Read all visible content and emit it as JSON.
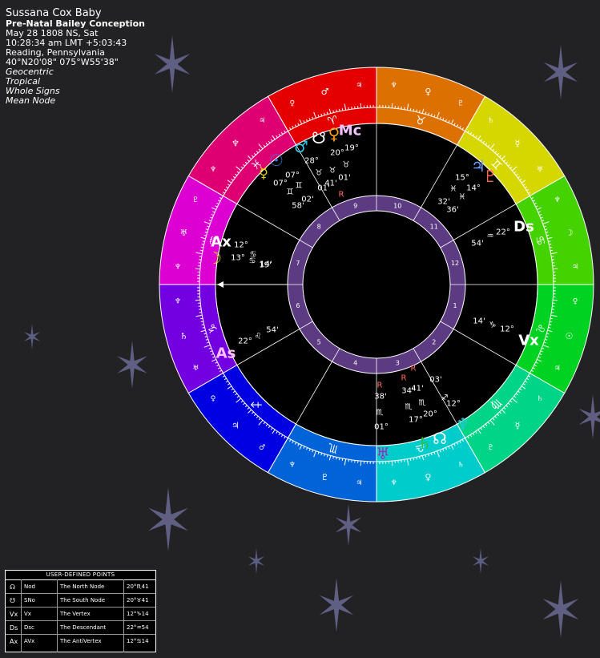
{
  "header": {
    "name": "Sussana Cox Baby",
    "chart_type": "Pre-Natal Bailey Conception",
    "date": "May 28 1808 NS, Sat",
    "time": "10:28:34 am  LMT +5:03:43",
    "place": "Reading, Pennsylvania",
    "coords": "40°N20'08\" 075°W55'38\"",
    "settings": [
      "Geocentric",
      "Tropical",
      "Whole Signs",
      "Mean Node"
    ]
  },
  "colors": {
    "background": "#222123",
    "star": "#6a6a94",
    "inner_ring": "#5c3b82",
    "wheel_center": "#000000",
    "aspect_red": "#ff7060"
  },
  "signs": [
    {
      "glyph": "♈",
      "name": "Aries",
      "color": "#e40000",
      "ruler": "♂",
      "sub": [
        "♀",
        "♃"
      ]
    },
    {
      "glyph": "♓",
      "name": "Pisces",
      "color": "#de0072",
      "ruler": "♆",
      "sub": [
        "♆",
        "♃"
      ]
    },
    {
      "glyph": "♒",
      "name": "Aquarius",
      "color": "#dc00d2",
      "ruler": "♅",
      "sub": [
        "♆",
        "♇"
      ]
    },
    {
      "glyph": "♑",
      "name": "Capricorn",
      "color": "#7200e0",
      "ruler": "♄",
      "sub": [
        "♅",
        "♆"
      ]
    },
    {
      "glyph": "♐",
      "name": "Sagittarius",
      "color": "#0000e0",
      "ruler": "♃",
      "sub": [
        "♂",
        "♀"
      ]
    },
    {
      "glyph": "♏",
      "name": "Scorpio",
      "color": "#0064d8",
      "ruler": "♇",
      "sub": [
        "♃",
        "♆"
      ]
    },
    {
      "glyph": "♎",
      "name": "Libra",
      "color": "#00cccc",
      "ruler": "♀",
      "sub": [
        "♄",
        "♆"
      ]
    },
    {
      "glyph": "♍",
      "name": "Virgo",
      "color": "#00d486",
      "ruler": "☿",
      "sub": [
        "♄",
        "♇"
      ]
    },
    {
      "glyph": "♌",
      "name": "Leo",
      "color": "#00d222",
      "ruler": "☉",
      "sub": [
        "♀",
        "♃"
      ]
    },
    {
      "glyph": "♋",
      "name": "Cancer",
      "color": "#44d200",
      "ruler": "☽",
      "sub": [
        "♆",
        "♃"
      ]
    },
    {
      "glyph": "♊",
      "name": "Gemini",
      "color": "#d6d600",
      "ruler": "☿",
      "sub": [
        "♄",
        "♅"
      ]
    },
    {
      "glyph": "♉",
      "name": "Taurus",
      "color": "#dc7000",
      "ruler": "♀",
      "sub": [
        "♆",
        "♇"
      ]
    }
  ],
  "houses": [
    "9",
    "8",
    "7",
    "6",
    "5",
    "4",
    "3",
    "2",
    "1",
    "12",
    "11",
    "10"
  ],
  "angles": [
    {
      "label": "Mc",
      "name": "Midheaven",
      "deg": "15°",
      "sign": "♉",
      "min": "36'"
    },
    {
      "label": "Ds",
      "name": "Descendant",
      "deg": "22°",
      "sign": "♒",
      "min": "54'"
    },
    {
      "label": "Vx",
      "name": "Vertex",
      "deg": "12°",
      "sign": "♑",
      "min": "14'"
    },
    {
      "label": "As",
      "name": "Ascendant",
      "deg": "22°",
      "sign": "♌",
      "min": "54'"
    },
    {
      "label": "Ax",
      "name": "AntiVertex",
      "deg": "12°",
      "sign": "♋",
      "min": "14'"
    }
  ],
  "planets": [
    {
      "glyph": "♀",
      "name": "Venus",
      "color": "#ff9c1a",
      "deg": "19°",
      "sign": "♉",
      "min": "01'",
      "retro": ""
    },
    {
      "glyph": "☋",
      "name": "South Node",
      "color": "#ffffff",
      "deg": "20°",
      "sign": "♉",
      "min": "41'",
      "retro": ""
    },
    {
      "glyph": "♂",
      "name": "Mars",
      "color": "#2ec4e0",
      "deg": "28°",
      "sign": "♉",
      "min": "01'",
      "retro": "R"
    },
    {
      "glyph": "☉",
      "name": "Sun",
      "color": "#3a7ae0",
      "deg": "07°",
      "sign": "♊",
      "min": "02'",
      "retro": ""
    },
    {
      "glyph": "☿",
      "name": "Mercury",
      "color": "#e0d020",
      "deg": "07°",
      "sign": "♊",
      "min": "58'",
      "retro": ""
    },
    {
      "glyph": "♃",
      "name": "Jupiter",
      "color": "#6fa0ff",
      "deg": "15°",
      "sign": "♓",
      "min": "32'",
      "retro": ""
    },
    {
      "glyph": "♇",
      "name": "Pluto",
      "color": "#ff6a50",
      "deg": "14°",
      "sign": "♓",
      "min": "36'",
      "retro": ""
    },
    {
      "glyph": "☽",
      "name": "Moon",
      "color": "#e8e020",
      "deg": "13°",
      "sign": "♋",
      "min": "19'",
      "retro": ""
    },
    {
      "glyph": "♆",
      "name": "Neptune",
      "color": "#20c8d8",
      "deg": "12°",
      "sign": "♐",
      "min": "03'",
      "retro": "R"
    },
    {
      "glyph": "☊",
      "name": "North Node",
      "color": "#ffffff",
      "deg": "20°",
      "sign": "♏",
      "min": "41'",
      "retro": ""
    },
    {
      "glyph": "♄",
      "name": "Saturn",
      "color": "#30c040",
      "deg": "17°",
      "sign": "♏",
      "min": "34'",
      "retro": "R"
    },
    {
      "glyph": "♅",
      "name": "Uranus",
      "color": "#a02ac0",
      "deg": "01°",
      "sign": "♏",
      "min": "38'",
      "retro": "R"
    }
  ],
  "user_points": {
    "title": "USER-DEFINED POINTS",
    "rows": [
      {
        "sym": "☊",
        "abbr": "Nod",
        "name": "The North Node",
        "pos": "20°♏41"
      },
      {
        "sym": "☋",
        "abbr": "SNo",
        "name": "The South Node",
        "pos": "20°♉41"
      },
      {
        "sym": "Vx",
        "abbr": "Vx",
        "name": "The Vertex",
        "pos": "12°♑14"
      },
      {
        "sym": "Ds",
        "abbr": "Dsc",
        "name": "The Descendant",
        "pos": "22°♒54"
      },
      {
        "sym": "Ax",
        "abbr": "AVx",
        "name": "The AntiVertex",
        "pos": "12°♋14"
      }
    ]
  }
}
